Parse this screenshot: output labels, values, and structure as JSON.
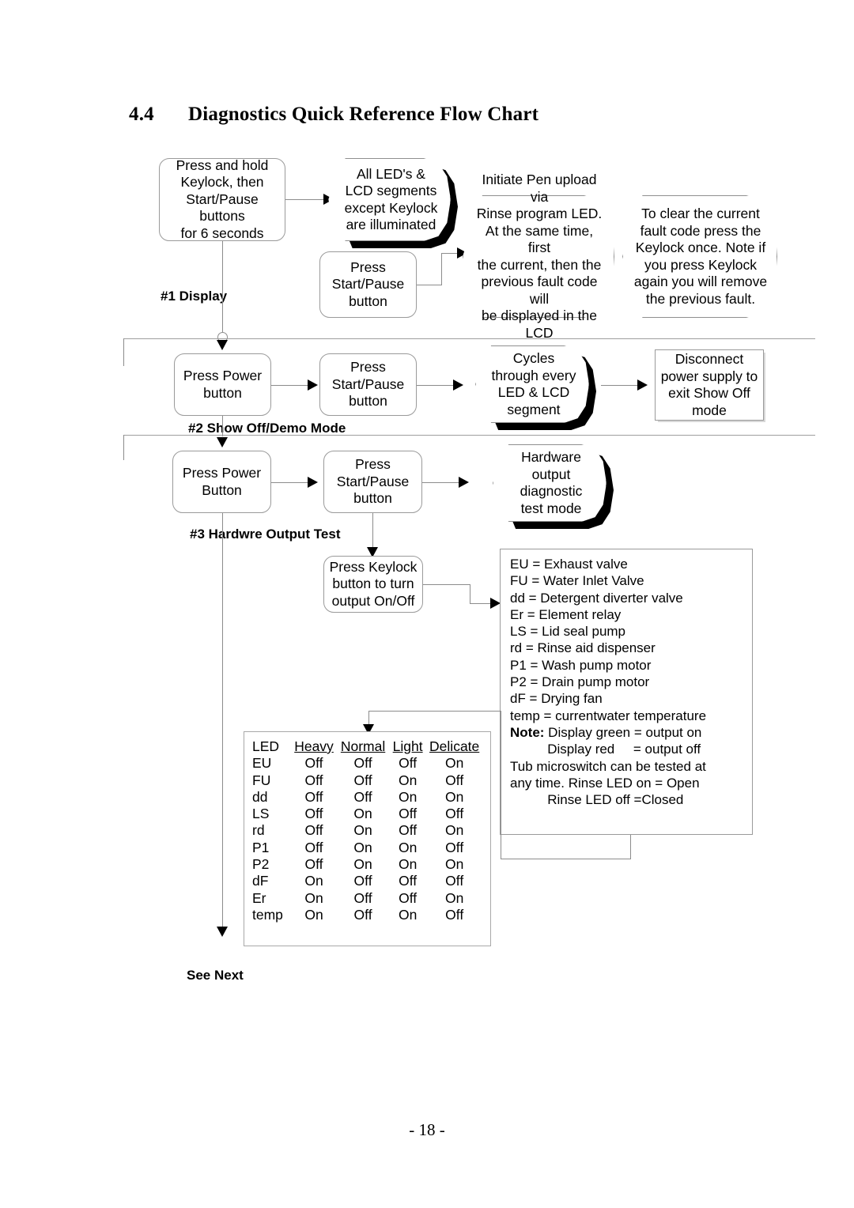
{
  "heading": {
    "number": "4.4",
    "title": "Diagnostics Quick Reference Flow Chart"
  },
  "page_number": "- 18 -",
  "sections": {
    "display": {
      "label": "#1 Display"
    },
    "showoff": {
      "label": "#2 Show Off/Demo Mode"
    },
    "hardware": {
      "label": "#3 Hardwre Output Test"
    }
  },
  "row1": {
    "step1": "Press and hold\nKeylock, then\nStart/Pause buttons\nfor 6 seconds",
    "step2": "All LED's &\nLCD segments\nexcept Keylock\nare illuminated",
    "step3": "Press\nStart/Pause\nbutton",
    "step4": "Initiate Pen upload via\nRinse program LED.\nAt the same time, first\nthe current, then the\nprevious fault code will\nbe displayed in the\nLCD",
    "step5": "To clear the current\nfault code press the\nKeylock once. Note if\nyou press Keylock\nagain you will remove\nthe previous fault."
  },
  "row2": {
    "step1": "Press Power\nbutton",
    "step2": "Press\nStart/Pause\nbutton",
    "step3": "Cycles\nthrough every\nLED & LCD\nsegment",
    "step4": "Disconnect\npower supply to\nexit Show Off\nmode"
  },
  "row3": {
    "step1": "Press Power\nButton",
    "step2": "Press\nStart/Pause\nbutton",
    "step3": "Hardware\noutput\ndiagnostic\ntest mode",
    "step4": "Press Keylock\nbutton to turn\noutput On/Off"
  },
  "legend": {
    "lines": [
      "EU = Exhaust valve",
      "FU = Water Inlet Valve",
      "dd = Detergent diverter valve",
      "Er = Element relay",
      "LS = Lid seal pump",
      "rd = Rinse aid dispenser",
      "P1 = Wash pump motor",
      "P2 = Drain pump motor",
      "dF = Drying fan",
      "temp = currentwater temperature"
    ],
    "note_label": "Note:",
    "note_line1": " Display green = output on",
    "note_line2": "          Display red     = output off",
    "note_line3": "Tub microswitch can be tested at",
    "note_line4": "any time. Rinse LED on = Open",
    "note_line5": "          Rinse LED off =Closed"
  },
  "chart_data": {
    "type": "table",
    "title": "LED output states per wash cycle",
    "columns": [
      "LED",
      "Heavy",
      "Normal",
      "Light",
      "Delicate"
    ],
    "rows": [
      [
        "EU",
        "Off",
        "Off",
        "Off",
        "On"
      ],
      [
        "FU",
        "Off",
        "Off",
        "On",
        "Off"
      ],
      [
        "dd",
        "Off",
        "Off",
        "On",
        "On"
      ],
      [
        "LS",
        "Off",
        "On",
        "Off",
        "Off"
      ],
      [
        "rd",
        "Off",
        "On",
        "Off",
        "On"
      ],
      [
        "P1",
        "Off",
        "On",
        "On",
        "Off"
      ],
      [
        "P2",
        "Off",
        "On",
        "On",
        "On"
      ],
      [
        "dF",
        "On",
        "Off",
        "Off",
        "Off"
      ],
      [
        "Er",
        "On",
        "Off",
        "Off",
        "On"
      ],
      [
        "temp",
        "On",
        "Off",
        "On",
        "Off"
      ]
    ]
  },
  "footer": {
    "see_next": "See Next"
  }
}
